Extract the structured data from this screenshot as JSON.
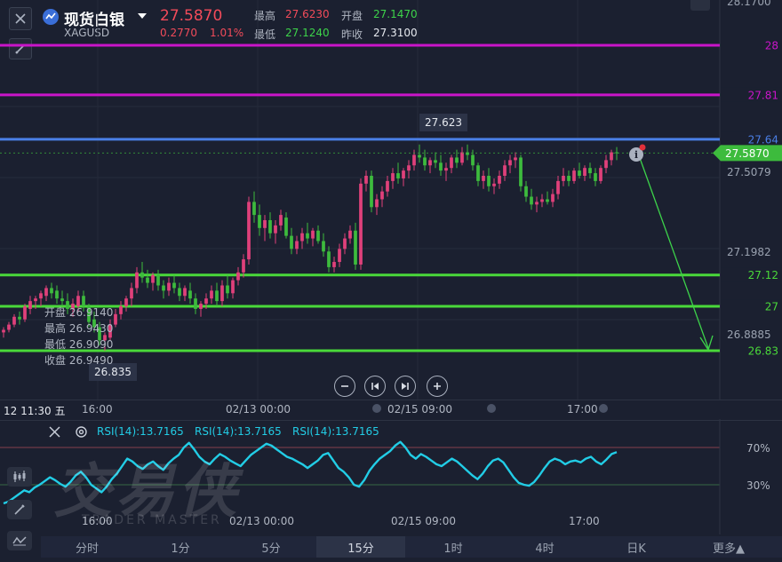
{
  "header": {
    "name": "现货白银",
    "symbol": "XAGUSD",
    "price": "27.5870",
    "change": "0.2770",
    "change_pct": "1.01%",
    "high_label": "最高",
    "high_value": "27.6230",
    "open_label": "开盘",
    "open_value": "27.1470",
    "low_label": "最低",
    "low_value": "27.1240",
    "prev_label": "昨收",
    "prev_value": "27.3100"
  },
  "colors": {
    "up": "#e0407a",
    "down": "#3dbb3d",
    "price_text_up": "#f24b5a",
    "green_text": "#3dd34a",
    "level_magenta": "#c915c9",
    "level_blue": "#4a7fe6",
    "level_green": "#4ad93a",
    "rsi_line": "#22cde6",
    "background": "#1b2030"
  },
  "price_axis": {
    "labels": [
      "28.1700",
      "27.5079",
      "27.1982",
      "26.8885"
    ],
    "current_price_tag": "27.5870"
  },
  "levels": [
    {
      "value": 28,
      "label": "28",
      "color": "#c915c9"
    },
    {
      "value": 27.81,
      "label": "27.81",
      "color": "#c915c9"
    },
    {
      "value": 27.64,
      "label": "27.64",
      "color": "#4a7fe6"
    },
    {
      "value": 27.12,
      "label": "27.12",
      "color": "#4ad93a"
    },
    {
      "value": 27,
      "label": "27",
      "color": "#4ad93a"
    },
    {
      "value": 26.83,
      "label": "26.83",
      "color": "#4ad93a"
    }
  ],
  "high_callout": "27.623",
  "low_callout": "26.835",
  "ohlc_readout": [
    {
      "label": "开盘",
      "value": "26.9140"
    },
    {
      "label": "最高",
      "value": "26.9430"
    },
    {
      "label": "最低",
      "value": "26.9090"
    },
    {
      "label": "收盘",
      "value": "26.9490"
    }
  ],
  "time_axis": {
    "corner": "12 11:30 五",
    "labels": [
      "16:00",
      "02/13 00:00",
      "02/15 09:00",
      "17:00"
    ]
  },
  "rsi": {
    "labels": [
      "RSI(14):13.7165",
      "RSI(14):13.7165",
      "RSI(14):13.7165"
    ],
    "upper_label": "70%",
    "lower_label": "30%",
    "upper": 70,
    "lower": 30,
    "time_labels": [
      "16:00",
      "02/13 00:00",
      "02/15 09:00",
      "17:00"
    ]
  },
  "watermark": {
    "cn": "交易侠",
    "en": "TRADER MASTER"
  },
  "tabs": [
    "分时",
    "1分",
    "5分",
    "15分",
    "1时",
    "4时",
    "日K",
    "更多▲"
  ],
  "active_tab": "15分",
  "chart_data": {
    "type": "candlestick",
    "ylim": [
      26.78,
      28.2
    ],
    "candles": [
      [
        26.9,
        26.92,
        26.88,
        26.91
      ],
      [
        26.91,
        26.94,
        26.9,
        26.93
      ],
      [
        26.93,
        26.97,
        26.92,
        26.96
      ],
      [
        26.96,
        26.98,
        26.93,
        26.95
      ],
      [
        26.95,
        27.01,
        26.94,
        27.0
      ],
      [
        26.99,
        27.04,
        26.97,
        27.02
      ],
      [
        27.02,
        27.04,
        26.99,
        27.03
      ],
      [
        27.03,
        27.06,
        27.0,
        27.05
      ],
      [
        27.04,
        27.08,
        27.02,
        27.07
      ],
      [
        27.07,
        27.09,
        27.03,
        27.05
      ],
      [
        27.06,
        27.08,
        27.01,
        27.03
      ],
      [
        27.03,
        27.06,
        27.0,
        27.02
      ],
      [
        27.02,
        27.05,
        26.97,
        26.99
      ],
      [
        26.99,
        27.03,
        26.96,
        27.01
      ],
      [
        27.0,
        27.06,
        26.98,
        27.04
      ],
      [
        27.04,
        27.06,
        26.98,
        27.0
      ],
      [
        27.0,
        27.01,
        26.92,
        26.94
      ],
      [
        26.95,
        26.98,
        26.9,
        26.92
      ],
      [
        26.92,
        26.94,
        26.85,
        26.87
      ],
      [
        26.87,
        26.9,
        26.83,
        26.89
      ],
      [
        26.88,
        26.95,
        26.87,
        26.93
      ],
      [
        26.93,
        26.99,
        26.92,
        26.97
      ],
      [
        26.97,
        27.02,
        26.95,
        27.0
      ],
      [
        27.0,
        27.04,
        26.98,
        27.03
      ],
      [
        27.03,
        27.09,
        27.0,
        27.07
      ],
      [
        27.07,
        27.15,
        27.05,
        27.13
      ],
      [
        27.13,
        27.17,
        27.09,
        27.11
      ],
      [
        27.11,
        27.14,
        27.07,
        27.09
      ],
      [
        27.09,
        27.13,
        27.06,
        27.12
      ],
      [
        27.12,
        27.14,
        27.06,
        27.08
      ],
      [
        27.08,
        27.1,
        27.03,
        27.06
      ],
      [
        27.06,
        27.11,
        27.04,
        27.09
      ],
      [
        27.09,
        27.12,
        27.05,
        27.07
      ],
      [
        27.07,
        27.09,
        27.02,
        27.04
      ],
      [
        27.04,
        27.08,
        27.02,
        27.07
      ],
      [
        27.06,
        27.09,
        27.01,
        27.03
      ],
      [
        27.03,
        27.05,
        26.97,
        26.99
      ],
      [
        26.99,
        27.02,
        26.96,
        27.01
      ],
      [
        27.01,
        27.05,
        26.99,
        27.03
      ],
      [
        27.03,
        27.08,
        27.01,
        27.06
      ],
      [
        27.06,
        27.09,
        27.0,
        27.02
      ],
      [
        27.02,
        27.1,
        27.0,
        27.08
      ],
      [
        27.08,
        27.12,
        27.03,
        27.05
      ],
      [
        27.05,
        27.11,
        27.03,
        27.1
      ],
      [
        27.1,
        27.15,
        27.08,
        27.13
      ],
      [
        27.13,
        27.2,
        27.11,
        27.18
      ],
      [
        27.18,
        27.42,
        27.16,
        27.4
      ],
      [
        27.4,
        27.44,
        27.32,
        27.35
      ],
      [
        27.35,
        27.39,
        27.27,
        27.3
      ],
      [
        27.3,
        27.35,
        27.25,
        27.33
      ],
      [
        27.33,
        27.36,
        27.26,
        27.28
      ],
      [
        27.28,
        27.33,
        27.24,
        27.31
      ],
      [
        27.31,
        27.37,
        27.29,
        27.35
      ],
      [
        27.34,
        27.36,
        27.26,
        27.27
      ],
      [
        27.27,
        27.3,
        27.2,
        27.22
      ],
      [
        27.22,
        27.27,
        27.2,
        27.25
      ],
      [
        27.25,
        27.3,
        27.22,
        27.28
      ],
      [
        27.28,
        27.32,
        27.24,
        27.26
      ],
      [
        27.26,
        27.3,
        27.23,
        27.29
      ],
      [
        27.29,
        27.31,
        27.24,
        27.25
      ],
      [
        27.25,
        27.28,
        27.19,
        27.21
      ],
      [
        27.21,
        27.23,
        27.13,
        27.15
      ],
      [
        27.15,
        27.19,
        27.13,
        27.17
      ],
      [
        27.17,
        27.24,
        27.15,
        27.22
      ],
      [
        27.22,
        27.28,
        27.2,
        27.26
      ],
      [
        27.26,
        27.31,
        27.24,
        27.29
      ],
      [
        27.29,
        27.32,
        27.14,
        27.16
      ],
      [
        27.16,
        27.49,
        27.14,
        27.47
      ],
      [
        27.47,
        27.52,
        27.44,
        27.5
      ],
      [
        27.5,
        27.52,
        27.36,
        27.38
      ],
      [
        27.38,
        27.43,
        27.35,
        27.41
      ],
      [
        27.41,
        27.46,
        27.38,
        27.44
      ],
      [
        27.44,
        27.5,
        27.42,
        27.48
      ],
      [
        27.48,
        27.53,
        27.45,
        27.51
      ],
      [
        27.51,
        27.55,
        27.47,
        27.49
      ],
      [
        27.49,
        27.53,
        27.46,
        27.52
      ],
      [
        27.52,
        27.56,
        27.49,
        27.54
      ],
      [
        27.54,
        27.6,
        27.52,
        27.58
      ],
      [
        27.58,
        27.62,
        27.55,
        27.57
      ],
      [
        27.57,
        27.6,
        27.52,
        27.54
      ],
      [
        27.54,
        27.57,
        27.51,
        27.56
      ],
      [
        27.56,
        27.59,
        27.53,
        27.55
      ],
      [
        27.55,
        27.58,
        27.5,
        27.52
      ],
      [
        27.52,
        27.55,
        27.48,
        27.53
      ],
      [
        27.53,
        27.58,
        27.51,
        27.57
      ],
      [
        27.57,
        27.6,
        27.53,
        27.55
      ],
      [
        27.55,
        27.61,
        27.54,
        27.59
      ],
      [
        27.59,
        27.62,
        27.56,
        27.58
      ],
      [
        27.58,
        27.6,
        27.52,
        27.54
      ],
      [
        27.54,
        27.55,
        27.46,
        27.48
      ],
      [
        27.48,
        27.52,
        27.45,
        27.5
      ],
      [
        27.5,
        27.53,
        27.44,
        27.46
      ],
      [
        27.46,
        27.49,
        27.43,
        27.47
      ],
      [
        27.47,
        27.52,
        27.45,
        27.5
      ],
      [
        27.5,
        27.56,
        27.48,
        27.54
      ],
      [
        27.54,
        27.58,
        27.51,
        27.56
      ],
      [
        27.56,
        27.59,
        27.53,
        27.57
      ],
      [
        27.57,
        27.58,
        27.44,
        27.46
      ],
      [
        27.46,
        27.48,
        27.4,
        27.42
      ],
      [
        27.42,
        27.45,
        27.37,
        27.39
      ],
      [
        27.39,
        27.42,
        27.36,
        27.4
      ],
      [
        27.4,
        27.43,
        27.38,
        27.41
      ],
      [
        27.41,
        27.44,
        27.39,
        27.4
      ],
      [
        27.4,
        27.45,
        27.38,
        27.43
      ],
      [
        27.43,
        27.5,
        27.41,
        27.48
      ],
      [
        27.48,
        27.53,
        27.46,
        27.5
      ],
      [
        27.5,
        27.52,
        27.46,
        27.48
      ],
      [
        27.48,
        27.53,
        27.47,
        27.52
      ],
      [
        27.52,
        27.55,
        27.49,
        27.5
      ],
      [
        27.5,
        27.54,
        27.48,
        27.53
      ],
      [
        27.53,
        27.55,
        27.49,
        27.51
      ],
      [
        27.51,
        27.53,
        27.46,
        27.48
      ],
      [
        27.48,
        27.54,
        27.47,
        27.53
      ],
      [
        27.53,
        27.58,
        27.51,
        27.56
      ],
      [
        27.56,
        27.6,
        27.54,
        27.59
      ],
      [
        27.59,
        27.61,
        27.56,
        27.587
      ]
    ],
    "rsi_values": [
      10,
      12,
      16,
      20,
      24,
      22,
      27,
      30,
      34,
      38,
      35,
      31,
      28,
      33,
      40,
      44,
      38,
      30,
      26,
      22,
      28,
      36,
      42,
      50,
      58,
      55,
      50,
      47,
      52,
      55,
      50,
      46,
      53,
      58,
      62,
      70,
      75,
      68,
      60,
      55,
      52,
      58,
      63,
      60,
      56,
      53,
      50,
      56,
      62,
      66,
      70,
      74,
      72,
      68,
      64,
      60,
      58,
      55,
      52,
      48,
      52,
      56,
      62,
      64,
      56,
      48,
      44,
      38,
      30,
      28,
      35,
      45,
      52,
      58,
      62,
      66,
      72,
      76,
      70,
      62,
      58,
      63,
      60,
      56,
      52,
      50,
      54,
      58,
      55,
      50,
      45,
      40,
      36,
      42,
      50,
      56,
      58,
      54,
      46,
      38,
      32,
      30,
      29,
      33,
      40,
      48,
      55,
      58,
      56,
      52,
      55,
      56,
      54,
      58,
      60,
      55,
      52,
      57,
      63,
      65
    ]
  }
}
